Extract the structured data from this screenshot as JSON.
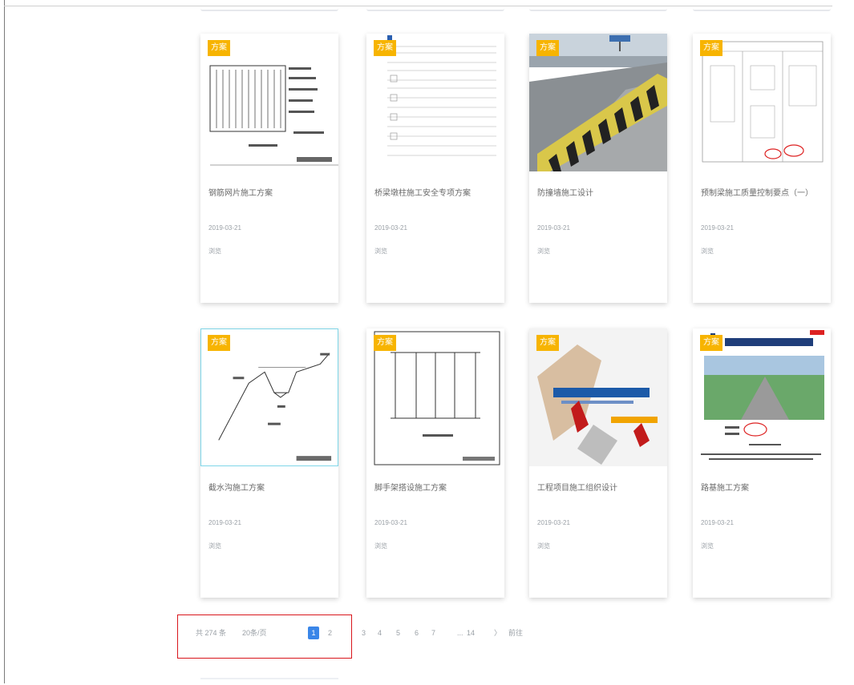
{
  "cards": [
    {
      "badge": "方案",
      "title": "钢筋网片施工方案",
      "meta1": "2019-03-21",
      "meta2": "浏览"
    },
    {
      "badge": "方案",
      "title": "桥梁墩柱施工安全专项方案",
      "meta1": "2019-03-21",
      "meta2": "浏览"
    },
    {
      "badge": "方案",
      "title": "防撞墙施工设计",
      "meta1": "2019-03-21",
      "meta2": "浏览"
    },
    {
      "badge": "方案",
      "title": "预制梁施工质量控制要点（一）",
      "meta1": "2019-03-21",
      "meta2": "浏览"
    },
    {
      "badge": "方案",
      "title": "截水沟施工方案",
      "meta1": "2019-03-21",
      "meta2": "浏览"
    },
    {
      "badge": "方案",
      "title": "脚手架搭设施工方案",
      "meta1": "2019-03-21",
      "meta2": "浏览"
    },
    {
      "badge": "方案",
      "title": "工程项目施工组织设计",
      "meta1": "2019-03-21",
      "meta2": "浏览"
    },
    {
      "badge": "方案",
      "title": "路基施工方案",
      "meta1": "2019-03-21",
      "meta2": "浏览"
    }
  ],
  "pagination": {
    "total_label": "共 274 条",
    "size_label": "20条/页",
    "pages": [
      "1",
      "2",
      "3",
      "4",
      "5",
      "6",
      "7"
    ],
    "dots": "...",
    "last_page": "14",
    "next": "〉",
    "extra": "前往"
  },
  "colors": {
    "badge": "#f7b400",
    "active_page": "#3a86e8",
    "highlight_border": "#d9161c"
  }
}
